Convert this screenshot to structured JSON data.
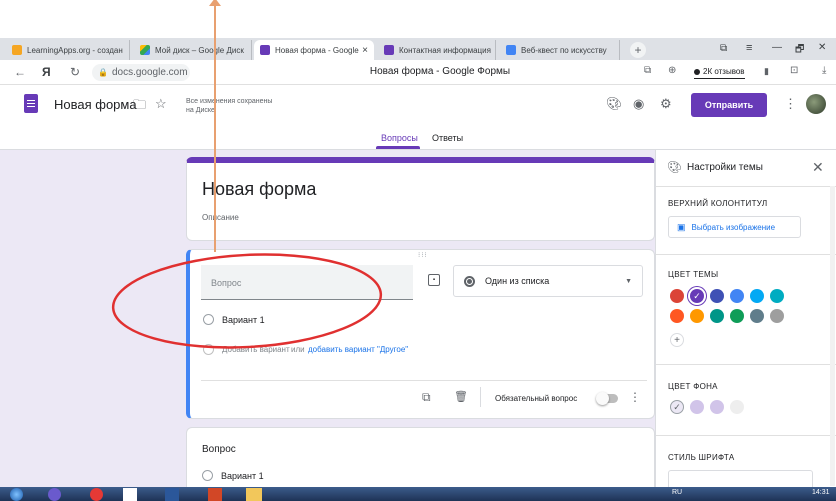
{
  "browser": {
    "tabs": [
      {
        "label": "LearningApps.org - создан",
        "color": "#f5a623"
      },
      {
        "label": "Мой диск – Google Диск",
        "color": "#34a853"
      },
      {
        "label": "Новая форма - Google",
        "color": "#673ab7",
        "active": true
      },
      {
        "label": "Контактная информация",
        "color": "#673ab7"
      },
      {
        "label": "Веб-квест по искусству",
        "color": "#4285f4"
      }
    ],
    "close_tab": "×",
    "new_tab": "+",
    "window_buttons": [
      "—",
      "🗗",
      "✕"
    ],
    "ya_label": "Я",
    "url": "docs.google.com",
    "page_title": "Новая форма - Google Формы",
    "reviews_badge": "2К отзывов"
  },
  "form_header": {
    "title": "Новая форма",
    "saved_status": "Все изменения сохранены\nна Диске",
    "send_button": "Отправить",
    "tabs": [
      "Вопросы",
      "Ответы"
    ],
    "accent": "#673ab7"
  },
  "form": {
    "title": "Новая форма",
    "description": "Описание",
    "question_placeholder": "Вопрос",
    "question_type": "Один из списка",
    "option1": "Вариант 1",
    "add_option": "Добавить вариант",
    "or": "или",
    "add_other": "добавить вариант \"Другое\"",
    "required": "Обязательный вопрос",
    "question2_title": "Вопрос",
    "question2_option": "Вариант 1"
  },
  "theme_panel": {
    "title": "Настройки темы",
    "header_label": "ВЕРХНИЙ КОЛОНТИТУЛ",
    "choose_image": "Выбрать изображение",
    "theme_color_label": "ЦВЕТ ТЕМЫ",
    "theme_colors": [
      "#db4437",
      "#673ab7",
      "#3f51b5",
      "#4285f4",
      "#03a9f4",
      "#00acc1",
      "#ff5722",
      "#ff9800",
      "#009688",
      "#0f9d58",
      "#607d8b",
      "#9e9e9e"
    ],
    "bg_color_label": "ЦВЕТ ФОНА",
    "bg_colors": [
      "#ece8f5",
      "#d1c4e9",
      "#d1c4e9",
      "#eeeeee"
    ],
    "font_style_label": "СТИЛЬ ШРИФТА"
  },
  "taskbar": {
    "lang": "RU",
    "time": "14:31"
  },
  "annotation_color": "#e03030"
}
